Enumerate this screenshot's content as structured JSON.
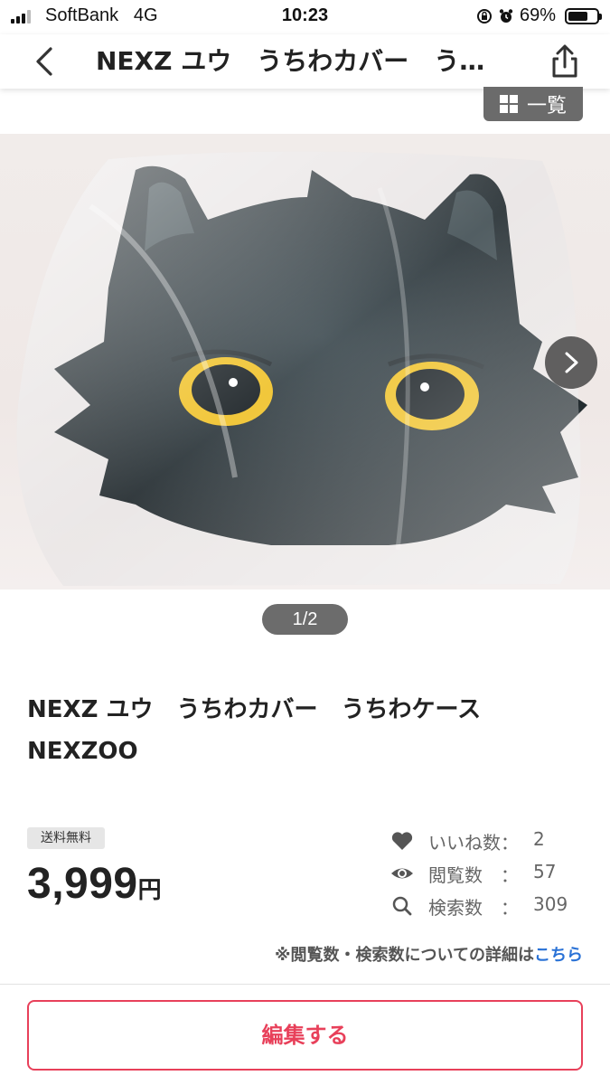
{
  "status_bar": {
    "carrier": "SoftBank",
    "network": "4G",
    "time": "10:23",
    "battery_percent": "69%",
    "battery_level": 0.69
  },
  "nav": {
    "title": "NEXZ ユウ　うちわカバー　う…"
  },
  "list_badge": {
    "label": "一覧"
  },
  "photo": {
    "page_indicator": "1/2"
  },
  "item": {
    "title": "NEXZ ユウ　うちわカバー　うちわケース NEXZOO",
    "shipping_badge": "送料無料",
    "price_value": "3,999",
    "price_unit": "円"
  },
  "stats": {
    "likes_label": "いいね数：",
    "likes_value": "2",
    "views_label": "閲覧数　：",
    "views_value": "57",
    "searches_label": "検索数　：",
    "searches_value": "309"
  },
  "note": {
    "text": "※閲覧数・検索数についての詳細は",
    "link": "こちら"
  },
  "actions": {
    "edit_label": "編集する"
  },
  "colors": {
    "accent": "#e8405a",
    "link": "#2a72d6",
    "cat_eye": "#f0c22a"
  }
}
